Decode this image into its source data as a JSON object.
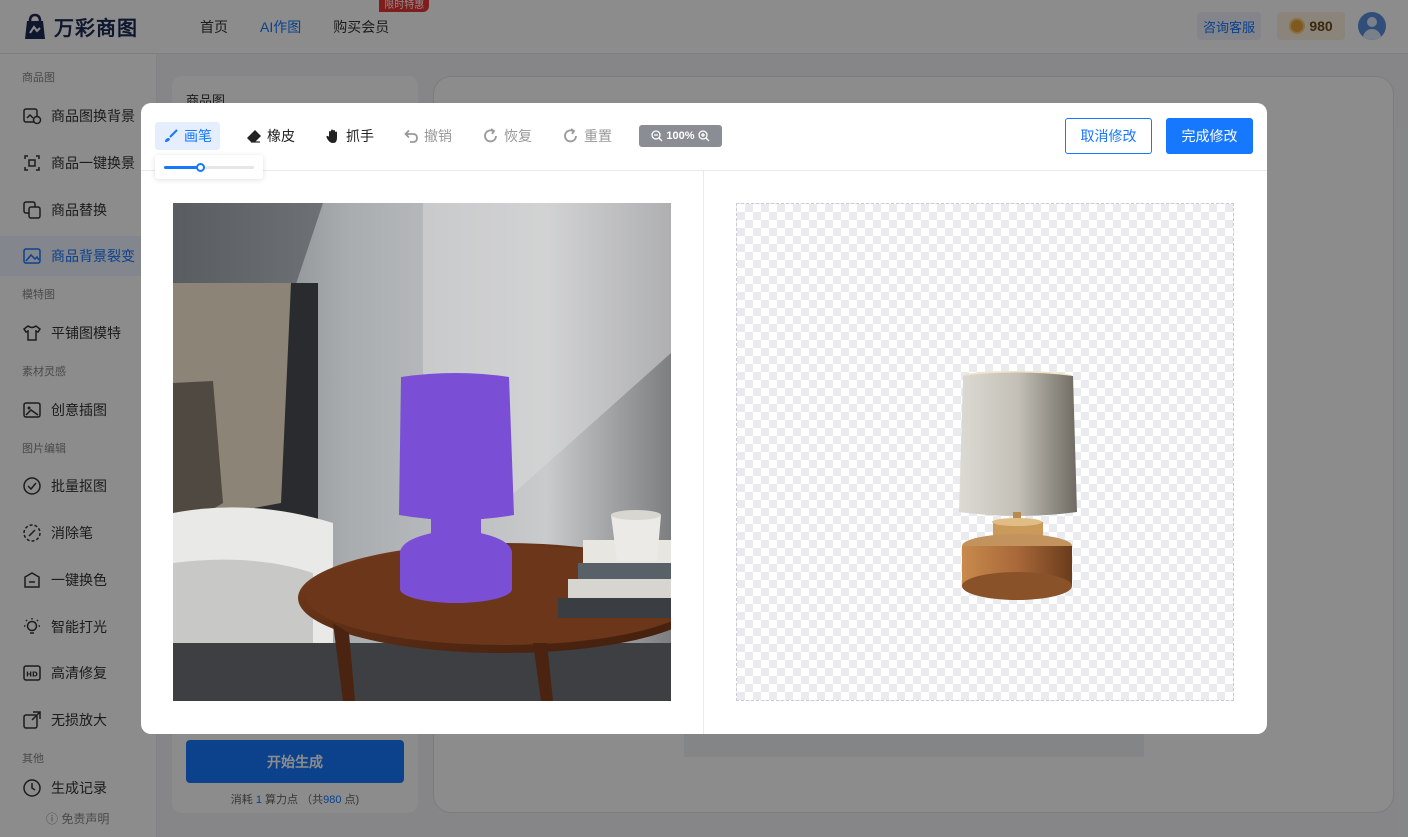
{
  "app": {
    "logo_text": "万彩商图"
  },
  "nav": {
    "items": [
      "首页",
      "AI作图",
      "购买会员"
    ],
    "active_index": 1,
    "hot_badge": "限时特惠",
    "consult_label": "咨询客服",
    "points": "980"
  },
  "sidebar": {
    "sections": [
      "商品图",
      "模特图",
      "素材灵感",
      "图片编辑",
      "其他"
    ],
    "items": [
      "商品图换背景",
      "商品一键换景",
      "商品替换",
      "商品背景裂变",
      "平铺图模特",
      "创意插图",
      "批量抠图",
      "消除笔",
      "一键换色",
      "智能打光",
      "高清修复",
      "无损放大",
      "生成记录"
    ],
    "active_index": 3,
    "disclaimer": "ⓘ 免责声明"
  },
  "left_panel": {
    "title": "商品图",
    "start_button": "开始生成",
    "cost_prefix": "消耗 ",
    "cost_value": "1",
    "cost_mid": " 算力点 （共",
    "cost_total": "980",
    "cost_suffix": " 点)"
  },
  "editor": {
    "tools": [
      "画笔",
      "橡皮",
      "抓手",
      "撤销",
      "恢复",
      "重置"
    ],
    "active_tool_index": 0,
    "disabled_tool_indices": [
      3,
      4,
      5
    ],
    "brush_size_fraction": 0.4,
    "zoom_label": "100%",
    "cancel_label": "取消修改",
    "done_label": "完成修改"
  },
  "colors": {
    "accent": "#1677ff",
    "mask": "#7a4fd6",
    "lamp_shade": "#c9c6bd",
    "lamp_base": "#a8683a"
  }
}
